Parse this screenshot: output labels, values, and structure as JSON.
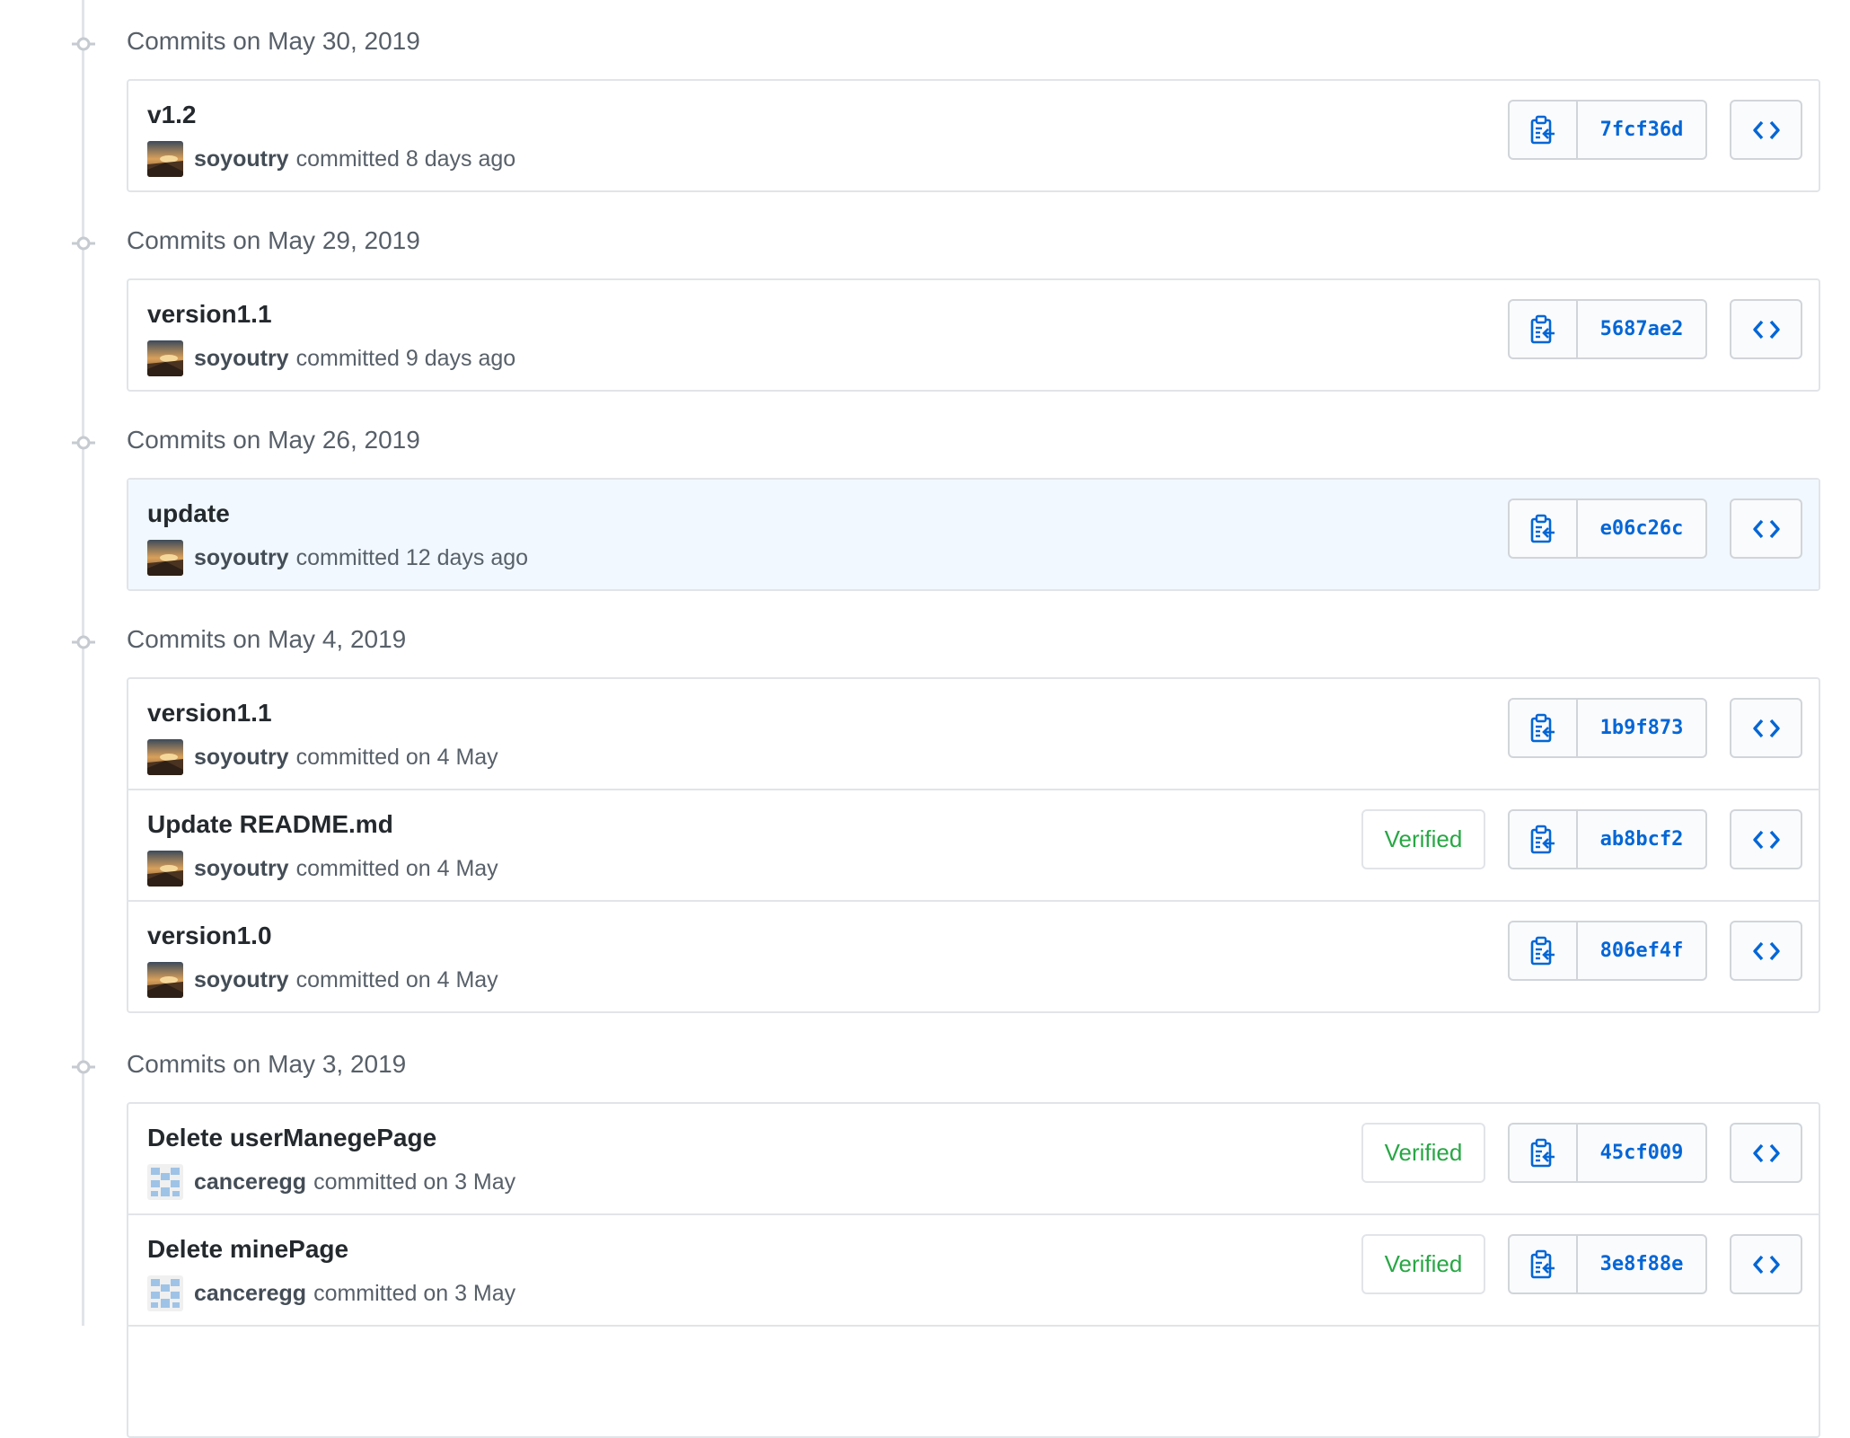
{
  "groups": [
    {
      "heading": "Commits on May 30, 2019",
      "commits": [
        {
          "message": "v1.2",
          "author": "soyoutry",
          "action": "committed 8 days ago",
          "sha": "7fcf36d",
          "verified": "",
          "avatar": "landscape"
        }
      ]
    },
    {
      "heading": "Commits on May 29, 2019",
      "commits": [
        {
          "message": "version1.1",
          "author": "soyoutry",
          "action": "committed 9 days ago",
          "sha": "5687ae2",
          "verified": "",
          "avatar": "landscape"
        }
      ]
    },
    {
      "heading": "Commits on May 26, 2019",
      "commits": [
        {
          "message": "update",
          "author": "soyoutry",
          "action": "committed 12 days ago",
          "sha": "e06c26c",
          "verified": "",
          "avatar": "landscape",
          "highlighted": true
        }
      ]
    },
    {
      "heading": "Commits on May 4, 2019",
      "commits": [
        {
          "message": "version1.1",
          "author": "soyoutry",
          "action": "committed on 4 May",
          "sha": "1b9f873",
          "verified": "",
          "avatar": "landscape"
        },
        {
          "message": "Update README.md",
          "author": "soyoutry",
          "action": "committed on 4 May",
          "sha": "ab8bcf2",
          "verified": "Verified",
          "avatar": "landscape"
        },
        {
          "message": "version1.0",
          "author": "soyoutry",
          "action": "committed on 4 May",
          "sha": "806ef4f",
          "verified": "",
          "avatar": "landscape"
        }
      ]
    },
    {
      "heading": "Commits on May 3, 2019",
      "commits": [
        {
          "message": "Delete userManegePage",
          "author": "canceregg",
          "action": "committed on 3 May",
          "sha": "45cf009",
          "verified": "Verified",
          "avatar": "identicon"
        },
        {
          "message": "Delete minePage",
          "author": "canceregg",
          "action": "committed on 3 May",
          "sha": "3e8f88e",
          "verified": "Verified",
          "avatar": "identicon"
        },
        {
          "message": "",
          "author": "",
          "action": "",
          "sha": "",
          "verified": "",
          "avatar": "none"
        }
      ]
    }
  ],
  "icons": {
    "commit_node": "git-commit-icon",
    "copy": "clipboard-copy-icon",
    "browse": "code-icon"
  },
  "colors": {
    "link": "#0366d6",
    "verified": "#28a745",
    "highlight": "#f1f8ff"
  }
}
